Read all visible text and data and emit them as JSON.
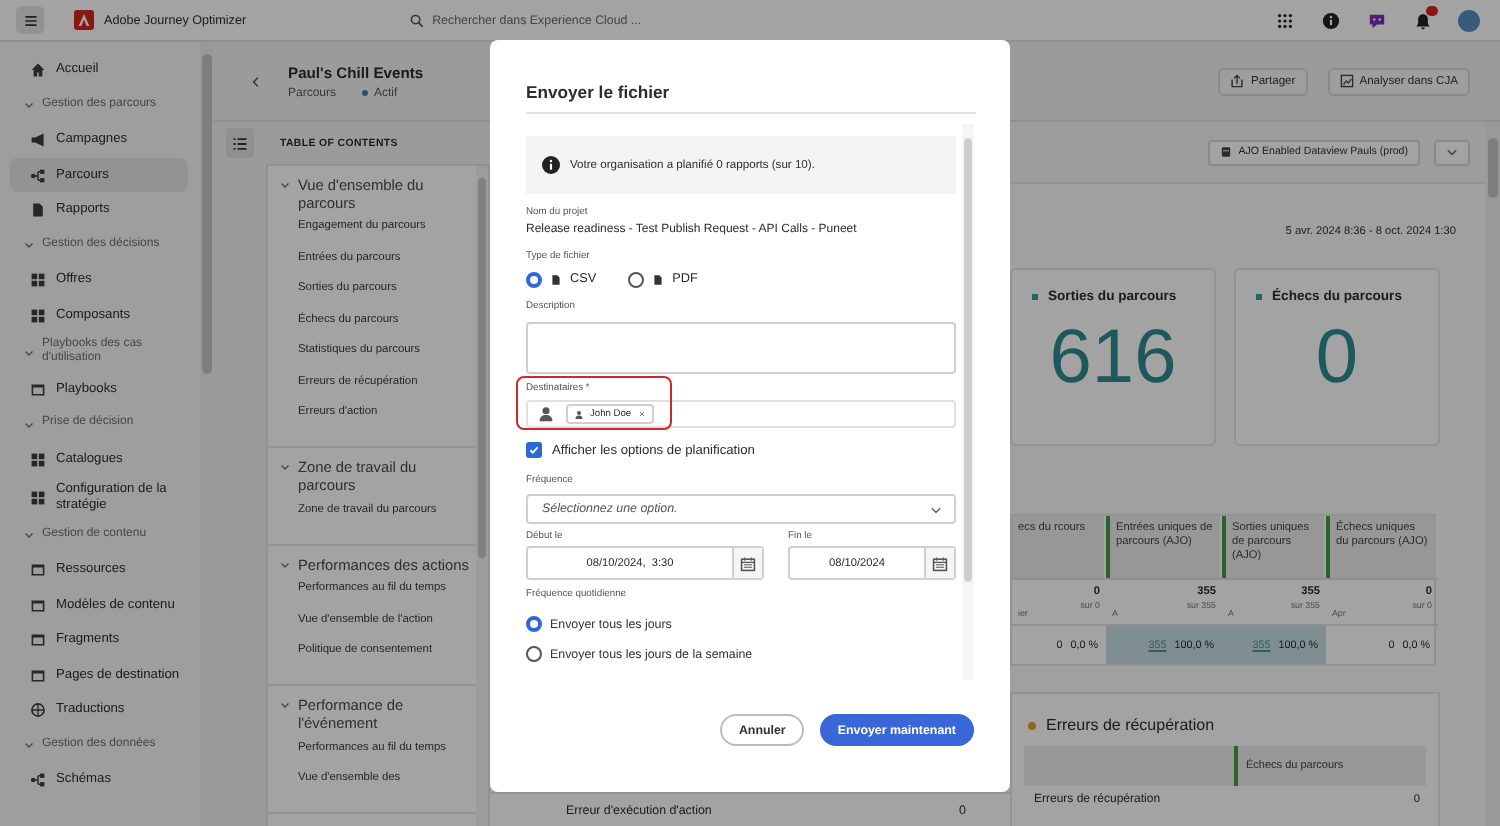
{
  "app_bar": {
    "product": "Adobe Journey Optimizer",
    "search": {
      "placeholder": "Rechercher dans Experience Cloud ..."
    }
  },
  "sidebar": {
    "items": [
      {
        "kind": "link",
        "label": "Accueil",
        "selected": false
      },
      {
        "kind": "section",
        "label": "Gestion des parcours",
        "expanded": true,
        "children": [
          {
            "label": "Campagnes",
            "selected": false
          },
          {
            "label": "Parcours",
            "selected": true
          },
          {
            "label": "Rapports",
            "selected": false
          }
        ]
      },
      {
        "kind": "section",
        "label": "Gestion des décisions",
        "expanded": true,
        "children": [
          {
            "label": "Offres",
            "selected": false
          },
          {
            "label": "Composants",
            "selected": false
          }
        ]
      },
      {
        "kind": "section",
        "label": "Playbooks des cas d'utilisation",
        "expanded": true,
        "children": [
          {
            "label": "Playbooks",
            "selected": false
          }
        ]
      },
      {
        "kind": "section",
        "label": "Prise de décision",
        "expanded": true,
        "children": [
          {
            "label": "Catalogues",
            "selected": false
          },
          {
            "label": "Configuration de la stratégie",
            "selected": false
          }
        ]
      },
      {
        "kind": "section",
        "label": "Gestion de contenu",
        "expanded": true,
        "children": [
          {
            "label": "Ressources",
            "selected": false
          },
          {
            "label": "Modèles de contenu",
            "selected": false
          },
          {
            "label": "Fragments",
            "selected": false
          },
          {
            "label": "Pages de destination",
            "selected": false
          },
          {
            "label": "Traductions",
            "selected": false
          }
        ]
      },
      {
        "kind": "section",
        "label": "Gestion des données",
        "expanded": true,
        "children": [
          {
            "label": "Schémas",
            "selected": false
          }
        ]
      }
    ]
  },
  "journey_header": {
    "title": "Paul's Chill Events",
    "type": "Parcours",
    "status": "Actif",
    "buttons": [
      "Partager",
      "Analyser dans CJA"
    ]
  },
  "toc": {
    "heading": "TABLE OF CONTENTS",
    "sections": [
      {
        "label": "Vue d'ensemble du parcours",
        "expanded": true,
        "children": [
          "Engagement du parcours",
          "Entrées du parcours",
          "Sorties du parcours",
          "Échecs du parcours",
          "Statistiques du parcours",
          "Erreurs de récupération",
          "Erreurs d'action"
        ]
      },
      {
        "label": "Zone de travail du parcours",
        "expanded": true,
        "children": [
          "Zone de travail du parcours"
        ]
      },
      {
        "label": "Performances des actions",
        "expanded": true,
        "children": [
          "Performances au fil du temps",
          "Vue d'ensemble de l'action",
          "Politique de consentement"
        ]
      },
      {
        "label": "Performance de l'événement",
        "expanded": true,
        "children": [
          "Performances au fil du temps",
          "Vue d'ensemble des"
        ]
      }
    ]
  },
  "report": {
    "dataview": "AJO Enabled Dataview Pauls (prod)",
    "date_range": "5 avr. 2024 8:36 - 8 oct. 2024 1:30",
    "metric_cards": [
      {
        "title": "Sorties du parcours",
        "value": "616"
      },
      {
        "title": "Échecs du parcours",
        "value": "0"
      }
    ],
    "table": {
      "columns": [
        "ecs du rcours",
        "Entrées uniques de parcours (AJO)",
        "Sorties uniques de parcours (AJO)",
        "Échecs uniques du parcours (AJO)"
      ],
      "rows": [
        {
          "kind": "trend",
          "cells": [
            {
              "tick": "ier",
              "value": "0",
              "sub": "sur 0"
            },
            {
              "tick": "A",
              "value": "355",
              "sub": "sur 355"
            },
            {
              "tick": "A",
              "value": "355",
              "sub": "sur 355"
            },
            {
              "tick": "Apr",
              "value": "0",
              "sub": "sur 0"
            }
          ]
        },
        {
          "kind": "share",
          "cells": [
            {
              "value": "0",
              "percent": "0,0 %",
              "highlighted": false
            },
            {
              "value": "355",
              "percent": "100,0 %",
              "highlighted": true
            },
            {
              "value": "355",
              "percent": "100,0 %",
              "highlighted": true
            },
            {
              "value": "0",
              "percent": "0,0 %",
              "highlighted": false
            }
          ]
        }
      ]
    },
    "recovery": {
      "title": "Erreurs de récupération",
      "column": "Échecs du parcours",
      "rows": [
        {
          "label": "Erreurs de récupération",
          "value": "0"
        }
      ]
    },
    "action_errors": {
      "label": "Erreur d'exécution d'action",
      "value": "0"
    }
  },
  "modal": {
    "title": "Envoyer le fichier",
    "notice": "Votre organisation a planifié 0 rapports (sur 10).",
    "project": {
      "label": "Nom du projet",
      "value": "Release readiness - Test Publish Request - API Calls - Puneet"
    },
    "file_type": {
      "label": "Type de fichier",
      "options": [
        {
          "label": "CSV",
          "selected": true
        },
        {
          "label": "PDF",
          "selected": false
        }
      ]
    },
    "description": {
      "label": "Description"
    },
    "recipients": {
      "label": "Destinataires *",
      "tags": [
        "John Doe"
      ],
      "highlighted": true
    },
    "schedule_toggle": {
      "label": "Afficher les options de planification",
      "checked": true
    },
    "frequency": {
      "label": "Fréquence",
      "placeholder": "Sélectionnez une option."
    },
    "start": {
      "label": "Début le",
      "value": "08/10/2024,  3:30"
    },
    "end": {
      "label": "Fin le",
      "value": "08/10/2024"
    },
    "daily": {
      "label": "Fréquence quotidienne",
      "options": [
        {
          "label": "Envoyer tous les jours",
          "selected": true
        },
        {
          "label": "Envoyer tous les jours de la semaine",
          "selected": false
        }
      ]
    },
    "buttons": [
      {
        "label": "Annuler",
        "kind": "secondary"
      },
      {
        "label": "Envoyer maintenant",
        "kind": "primary"
      }
    ]
  }
}
